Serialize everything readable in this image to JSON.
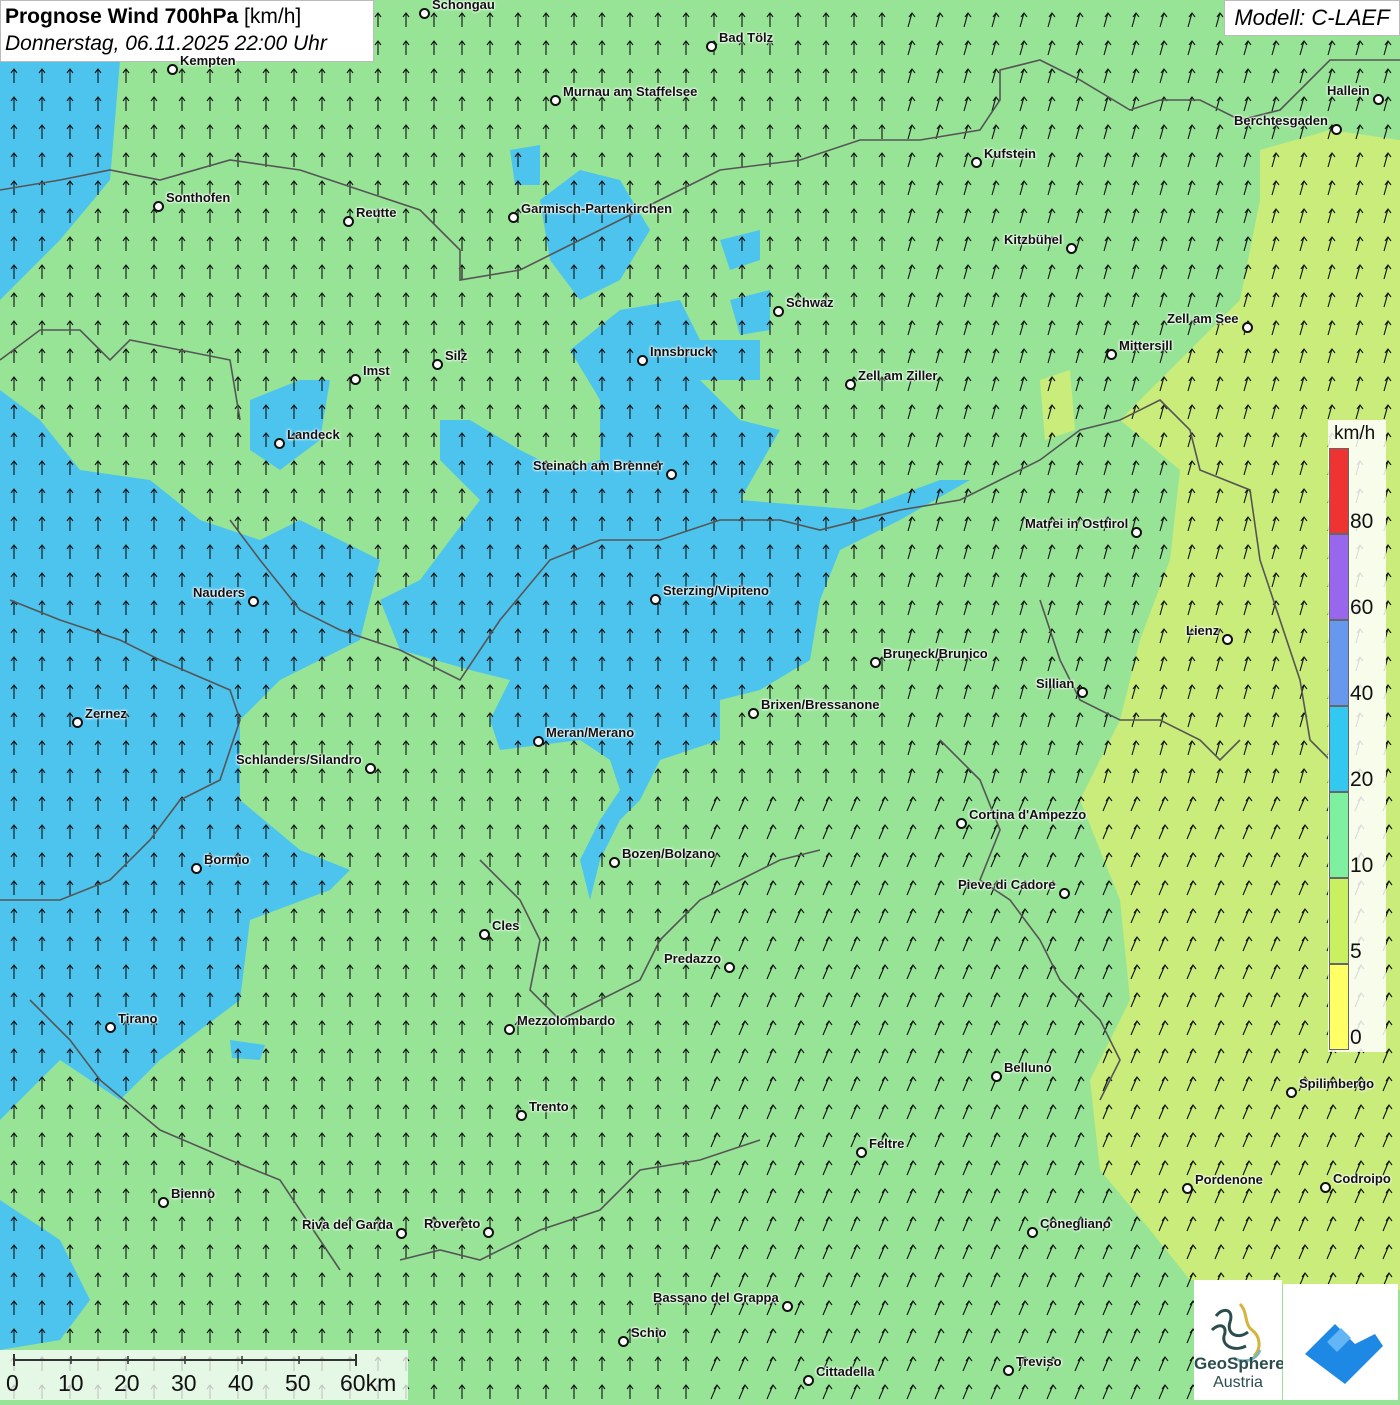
{
  "header": {
    "title_bold": "Prognose Wind 700hPa",
    "title_unit": "[km/h]",
    "datetime": "Donnerstag, 06.11.2025 22:00 Uhr",
    "model": "Modell: C-LAEF"
  },
  "legend": {
    "unit": "km/h",
    "bands": [
      {
        "from": 0,
        "to": 5,
        "color": "#ffff66"
      },
      {
        "from": 5,
        "to": 10,
        "color": "#c8f060"
      },
      {
        "from": 10,
        "to": 20,
        "color": "#7ff0a0"
      },
      {
        "from": 20,
        "to": 40,
        "color": "#33c8f0"
      },
      {
        "from": 40,
        "to": 60,
        "color": "#6699ee"
      },
      {
        "from": 60,
        "to": 80,
        "color": "#9966ee"
      },
      {
        "from": 80,
        "to": 100,
        "color": "#ee3333"
      }
    ],
    "ticks": [
      "0",
      "5",
      "10",
      "20",
      "40",
      "60",
      "80"
    ]
  },
  "scale": {
    "labels": [
      "0",
      "10",
      "20",
      "30",
      "40",
      "50",
      "60km"
    ]
  },
  "cities": [
    {
      "name": "Schongau"
    },
    {
      "name": "Bad Tölz"
    },
    {
      "name": "Kempten"
    },
    {
      "name": "Murnau am Staffelsee"
    },
    {
      "name": "Hallein"
    },
    {
      "name": "Berchtesgaden"
    },
    {
      "name": "Kufstein"
    },
    {
      "name": "Sonthofen"
    },
    {
      "name": "Reutte"
    },
    {
      "name": "Garmisch-Partenkirchen"
    },
    {
      "name": "Kitzbühel"
    },
    {
      "name": "Schwaz"
    },
    {
      "name": "Zell am See"
    },
    {
      "name": "Mittersill"
    },
    {
      "name": "Innsbruck"
    },
    {
      "name": "Silz"
    },
    {
      "name": "Imst"
    },
    {
      "name": "Zell am Ziller"
    },
    {
      "name": "Landeck"
    },
    {
      "name": "Steinach am Brenner"
    },
    {
      "name": "Matrei in Osttirol"
    },
    {
      "name": "Nauders"
    },
    {
      "name": "Sterzing/Vipiteno"
    },
    {
      "name": "Lienz"
    },
    {
      "name": "Bruneck/Brunico"
    },
    {
      "name": "Sillian"
    },
    {
      "name": "Zernez"
    },
    {
      "name": "Brixen/Bressanone"
    },
    {
      "name": "Meran/Merano"
    },
    {
      "name": "Schlanders/Silandro"
    },
    {
      "name": "Cortina d'Ampezzo"
    },
    {
      "name": "Bozen/Bolzano"
    },
    {
      "name": "Bormio"
    },
    {
      "name": "Pieve di Cadore"
    },
    {
      "name": "Cles"
    },
    {
      "name": "Predazzo"
    },
    {
      "name": "Tirano"
    },
    {
      "name": "Mezzolombardo"
    },
    {
      "name": "Belluno"
    },
    {
      "name": "Spilimbergo"
    },
    {
      "name": "Trento"
    },
    {
      "name": "Feltre"
    },
    {
      "name": "Pordenone"
    },
    {
      "name": "Codroipo"
    },
    {
      "name": "Bienno"
    },
    {
      "name": "Riva del Garda"
    },
    {
      "name": "Rovereto"
    },
    {
      "name": "Conegliano"
    },
    {
      "name": "Bassano del Grappa"
    },
    {
      "name": "Schio"
    },
    {
      "name": "Treviso"
    },
    {
      "name": "Cittadella"
    }
  ],
  "logos": {
    "geosphere_line1": "GeoSphere",
    "geosphere_line2": "Austria"
  }
}
